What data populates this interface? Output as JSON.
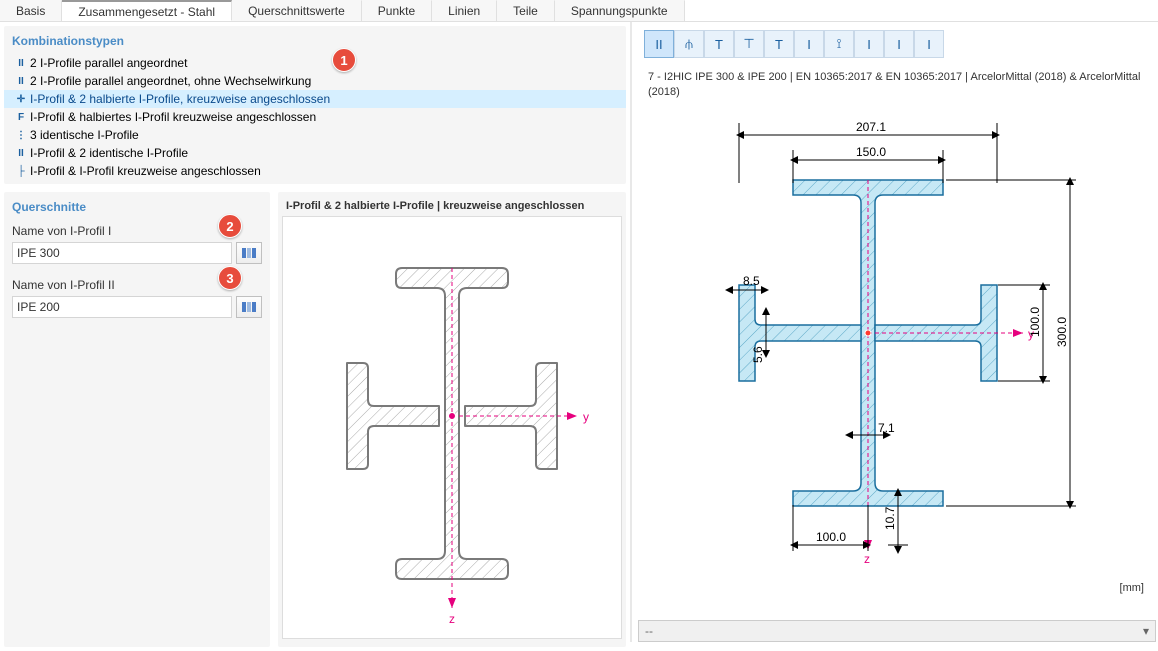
{
  "tabs": [
    {
      "label": "Basis",
      "active": false
    },
    {
      "label": "Zusammengesetzt - Stahl",
      "active": true
    },
    {
      "label": "Querschnittswerte",
      "active": false
    },
    {
      "label": "Punkte",
      "active": false
    },
    {
      "label": "Linien",
      "active": false
    },
    {
      "label": "Teile",
      "active": false
    },
    {
      "label": "Spannungspunkte",
      "active": false
    }
  ],
  "combination": {
    "title": "Kombinationstypen",
    "items": [
      {
        "icon": "II",
        "label": "2 I-Profile parallel angeordnet",
        "selected": false
      },
      {
        "icon": "II",
        "label": "2 I-Profile parallel angeordnet, ohne Wechselwirkung",
        "selected": false
      },
      {
        "icon": "✛",
        "label": "I-Profil & 2 halbierte I-Profile, kreuzweise angeschlossen",
        "selected": true
      },
      {
        "icon": "F",
        "label": "I-Profil & halbiertes I-Profil kreuzweise angeschlossen",
        "selected": false
      },
      {
        "icon": "⋮",
        "label": "3 identische I-Profile",
        "selected": false
      },
      {
        "icon": "II",
        "label": "I-Profil & 2 identische I-Profile",
        "selected": false
      },
      {
        "icon": "├",
        "label": "I-Profil & I-Profil kreuzweise angeschlossen",
        "selected": false
      }
    ]
  },
  "cross_sections": {
    "title": "Querschnitte",
    "field1_label": "Name von I-Profil I",
    "field1_value": "IPE 300",
    "field2_label": "Name von I-Profil II",
    "field2_value": "IPE 200"
  },
  "preview": {
    "title": "I-Profil & 2 halbierte I-Profile | kreuzweise angeschlossen",
    "axis_y": "y",
    "axis_z": "z"
  },
  "right": {
    "section_name": "7 - I2HIC IPE 300 & IPE 200 | EN 10365:2017 & EN 10365:2017 | ArcelorMittal (2018) & ArcelorMittal (2018)",
    "dims": {
      "top_outer": "207.1",
      "top_inner": "150.0",
      "side_inner": "100.0",
      "side_outer": "300.0",
      "bottom_left": "100.0",
      "bottom_right": "10.7",
      "web": "7.1",
      "flange_side": "8.5",
      "flange_mid": "5.6"
    },
    "unit": "[mm]",
    "dropdown": "--",
    "axis_y": "y",
    "axis_z": "z"
  },
  "badges": {
    "b1": "1",
    "b2": "2",
    "b3": "3"
  }
}
